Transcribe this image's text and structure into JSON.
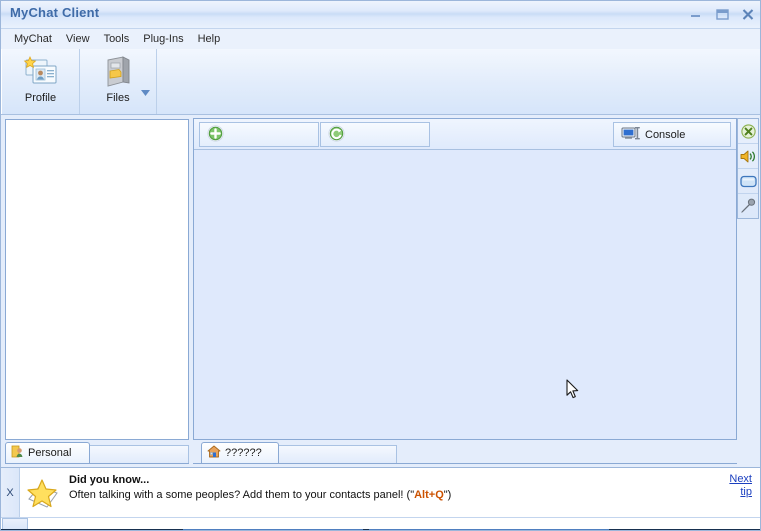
{
  "window": {
    "title": "MyChat Client",
    "controls": [
      {
        "name": "minimize",
        "label": "Minimize"
      },
      {
        "name": "maximize",
        "label": "Maximize"
      },
      {
        "name": "close",
        "label": "Close"
      }
    ]
  },
  "menubar": {
    "items": [
      {
        "label": "MyChat"
      },
      {
        "label": "View"
      },
      {
        "label": "Tools"
      },
      {
        "label": "Plug-Ins"
      },
      {
        "label": "Help"
      }
    ]
  },
  "toolbar": {
    "buttons": [
      {
        "label": "Profile",
        "icon": "profile-card-icon",
        "has_dropdown": false
      },
      {
        "label": "Files",
        "icon": "file-cabinet-icon",
        "has_dropdown": true
      }
    ]
  },
  "chat_toolbar": {
    "buttons": [
      {
        "label": "",
        "icon": "add-green-plus-icon",
        "disabled": true
      },
      {
        "label": "",
        "icon": "refresh-green-arrows-icon",
        "disabled": true
      }
    ],
    "console_button": {
      "label": "Console",
      "icon": "monitor-icon"
    }
  },
  "icon_strip": {
    "icons": [
      {
        "name": "close-green-icon"
      },
      {
        "name": "speaker-sound-icon"
      },
      {
        "name": "display-window-icon"
      },
      {
        "name": "pin-tool-icon"
      }
    ]
  },
  "left_panel": {
    "tabs": [
      {
        "label": "Personal",
        "icon": "contact-person-icon",
        "active": true
      }
    ]
  },
  "chat_tabs": {
    "tabs": [
      {
        "label": "??????",
        "icon": "home-house-icon",
        "active": true
      }
    ]
  },
  "tip": {
    "close_label": "X",
    "icon": "star-book-icon",
    "title": "Did you know...",
    "text_before": "Often talking with a some peoples? Add them to your contacts panel! (\"",
    "hotkey": "Alt+Q",
    "text_after": "\")",
    "link_line1": "Next",
    "link_line2": "tip"
  },
  "colors": {
    "title_text": "#3f6ba8",
    "accent_link": "#1b3fbf",
    "hotkey": "#cc5200",
    "panel_bg": "#dfe9fc",
    "border": "#8aa9d4"
  }
}
